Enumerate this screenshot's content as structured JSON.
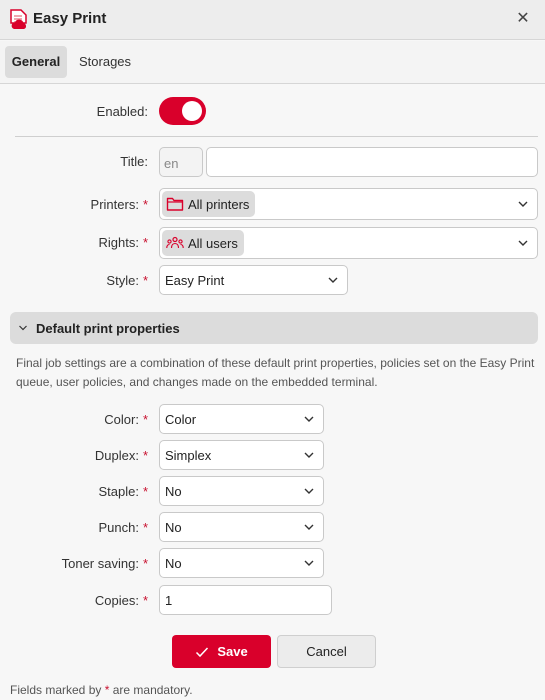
{
  "window": {
    "title": "Easy Print",
    "icon": "print-document-cloud-icon",
    "close_icon": "close-icon",
    "close_glyph": "✕"
  },
  "tabs": [
    {
      "label": "General",
      "active": true
    },
    {
      "label": "Storages",
      "active": false
    }
  ],
  "form": {
    "enabled": {
      "label": "Enabled:",
      "value": true
    },
    "title": {
      "label": "Title:",
      "lang": "en",
      "value": ""
    },
    "printers": {
      "label": "Printers:",
      "required_mark": "*",
      "chip": "All printers",
      "chip_icon": "folder-icon"
    },
    "rights": {
      "label": "Rights:",
      "required_mark": "*",
      "chip": "All users",
      "chip_icon": "users-group-icon"
    },
    "style": {
      "label": "Style:",
      "required_mark": "*",
      "value": "Easy Print"
    }
  },
  "section": {
    "title": "Default print properties",
    "expanded": true,
    "description": "Final job settings are a combination of these default print properties, policies set on the Easy Print queue, user policies, and changes made on the embedded terminal.",
    "fields": [
      {
        "label": "Color:",
        "required_mark": "*",
        "value": "Color",
        "type": "select"
      },
      {
        "label": "Duplex:",
        "required_mark": "*",
        "value": "Simplex",
        "type": "select"
      },
      {
        "label": "Staple:",
        "required_mark": "*",
        "value": "No",
        "type": "select"
      },
      {
        "label": "Punch:",
        "required_mark": "*",
        "value": "No",
        "type": "select"
      },
      {
        "label": "Toner saving:",
        "required_mark": "*",
        "value": "No",
        "type": "select"
      },
      {
        "label": "Copies:",
        "required_mark": "*",
        "value": "1",
        "type": "number"
      }
    ]
  },
  "actions": {
    "save_label": "Save",
    "cancel_label": "Cancel"
  },
  "footer": {
    "note_prefix": "Fields marked by",
    "note_mark": "*",
    "note_suffix": "are mandatory."
  },
  "colors": {
    "accent": "#d9002b",
    "chip_bg": "#dcdcdc",
    "background": "#f7f7f7"
  }
}
